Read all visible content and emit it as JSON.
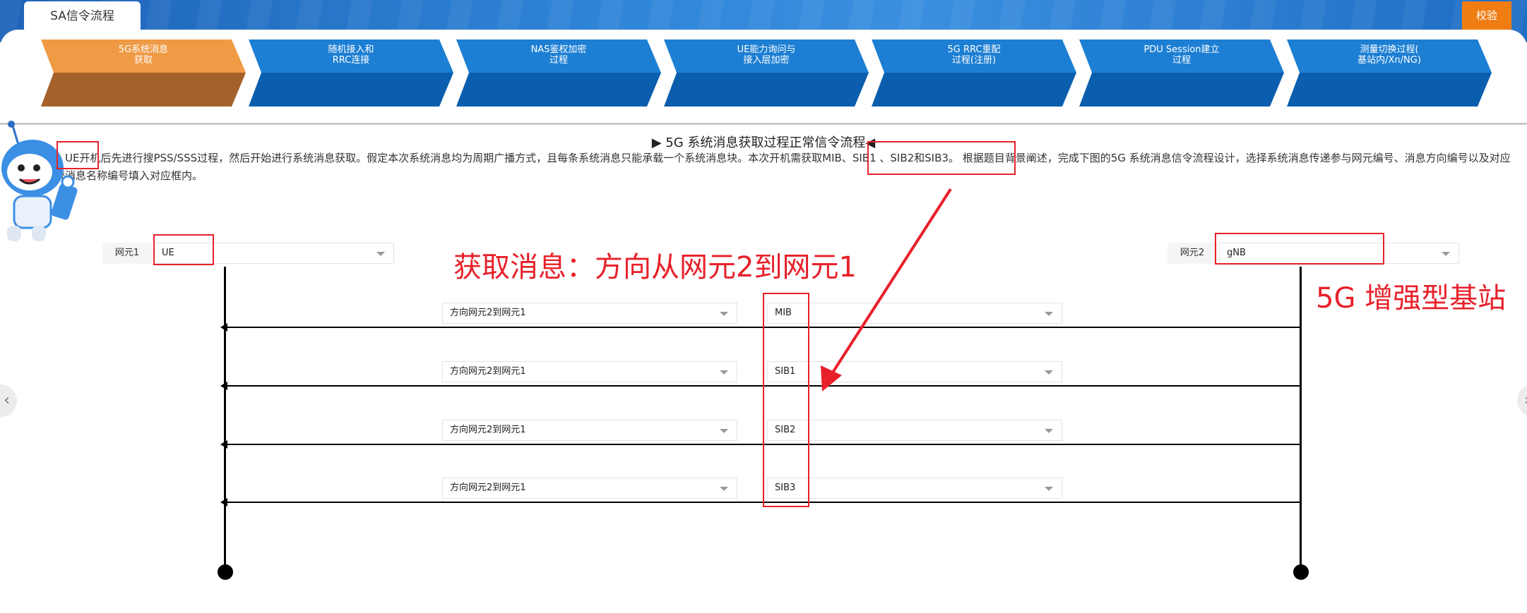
{
  "header": {
    "tab_label": "SA信令流程",
    "verify_label": "校验"
  },
  "steps": [
    {
      "label": "5G系统消息\n获取",
      "state": "active"
    },
    {
      "label": "随机接入和\nRRC连接",
      "state": "normal"
    },
    {
      "label": "NAS鉴权加密\n过程",
      "state": "normal"
    },
    {
      "label": "UE能力询问与\n接入层加密",
      "state": "normal"
    },
    {
      "label": "5G RRC重配\n过程(注册)",
      "state": "normal"
    },
    {
      "label": "PDU Session建立\n过程",
      "state": "normal"
    },
    {
      "label": "测量切换过程(\n基站内/Xn/NG)",
      "state": "normal"
    }
  ],
  "section": {
    "title": "▶ 5G 系统消息获取过程正常信令流程◀",
    "description": "当，UE开机后先进行搜PSS/SSS过程，然后开始进行系统消息获取。假定本次系统消息均为周期广播方式，且每条系统消息只能承载一个系统消息块。本次开机需获取MIB、SIB1 、SIB2和SIB3。 根据题目背景阐述，完成下图的5G 系统消息信令流程设计，选择系统消息传递参与网元编号、消息方向编号以及对应系统消息名称编号填入对应框内。"
  },
  "network_elements": {
    "ne1": {
      "label": "网元1",
      "value": "UE"
    },
    "ne2": {
      "label": "网元2",
      "value": "gNB"
    }
  },
  "messages": [
    {
      "direction": "方向网元2到网元1",
      "name": "MIB"
    },
    {
      "direction": "方向网元2到网元1",
      "name": "SIB1"
    },
    {
      "direction": "方向网元2到网元1",
      "name": "SIB2"
    },
    {
      "direction": "方向网元2到网元1",
      "name": "SIB3"
    }
  ],
  "annotations": {
    "direction_note": "获取消息：方向从网元2到网元1",
    "gnb_note": "5G 增强型基站",
    "color": "#e8202a"
  },
  "colors": {
    "active_step_top": "#ef9a45",
    "active_step_bottom": "#a4622a",
    "step_top": "#1d7fd3",
    "step_bottom": "#0b5eae",
    "verify_button": "#f07d14"
  }
}
